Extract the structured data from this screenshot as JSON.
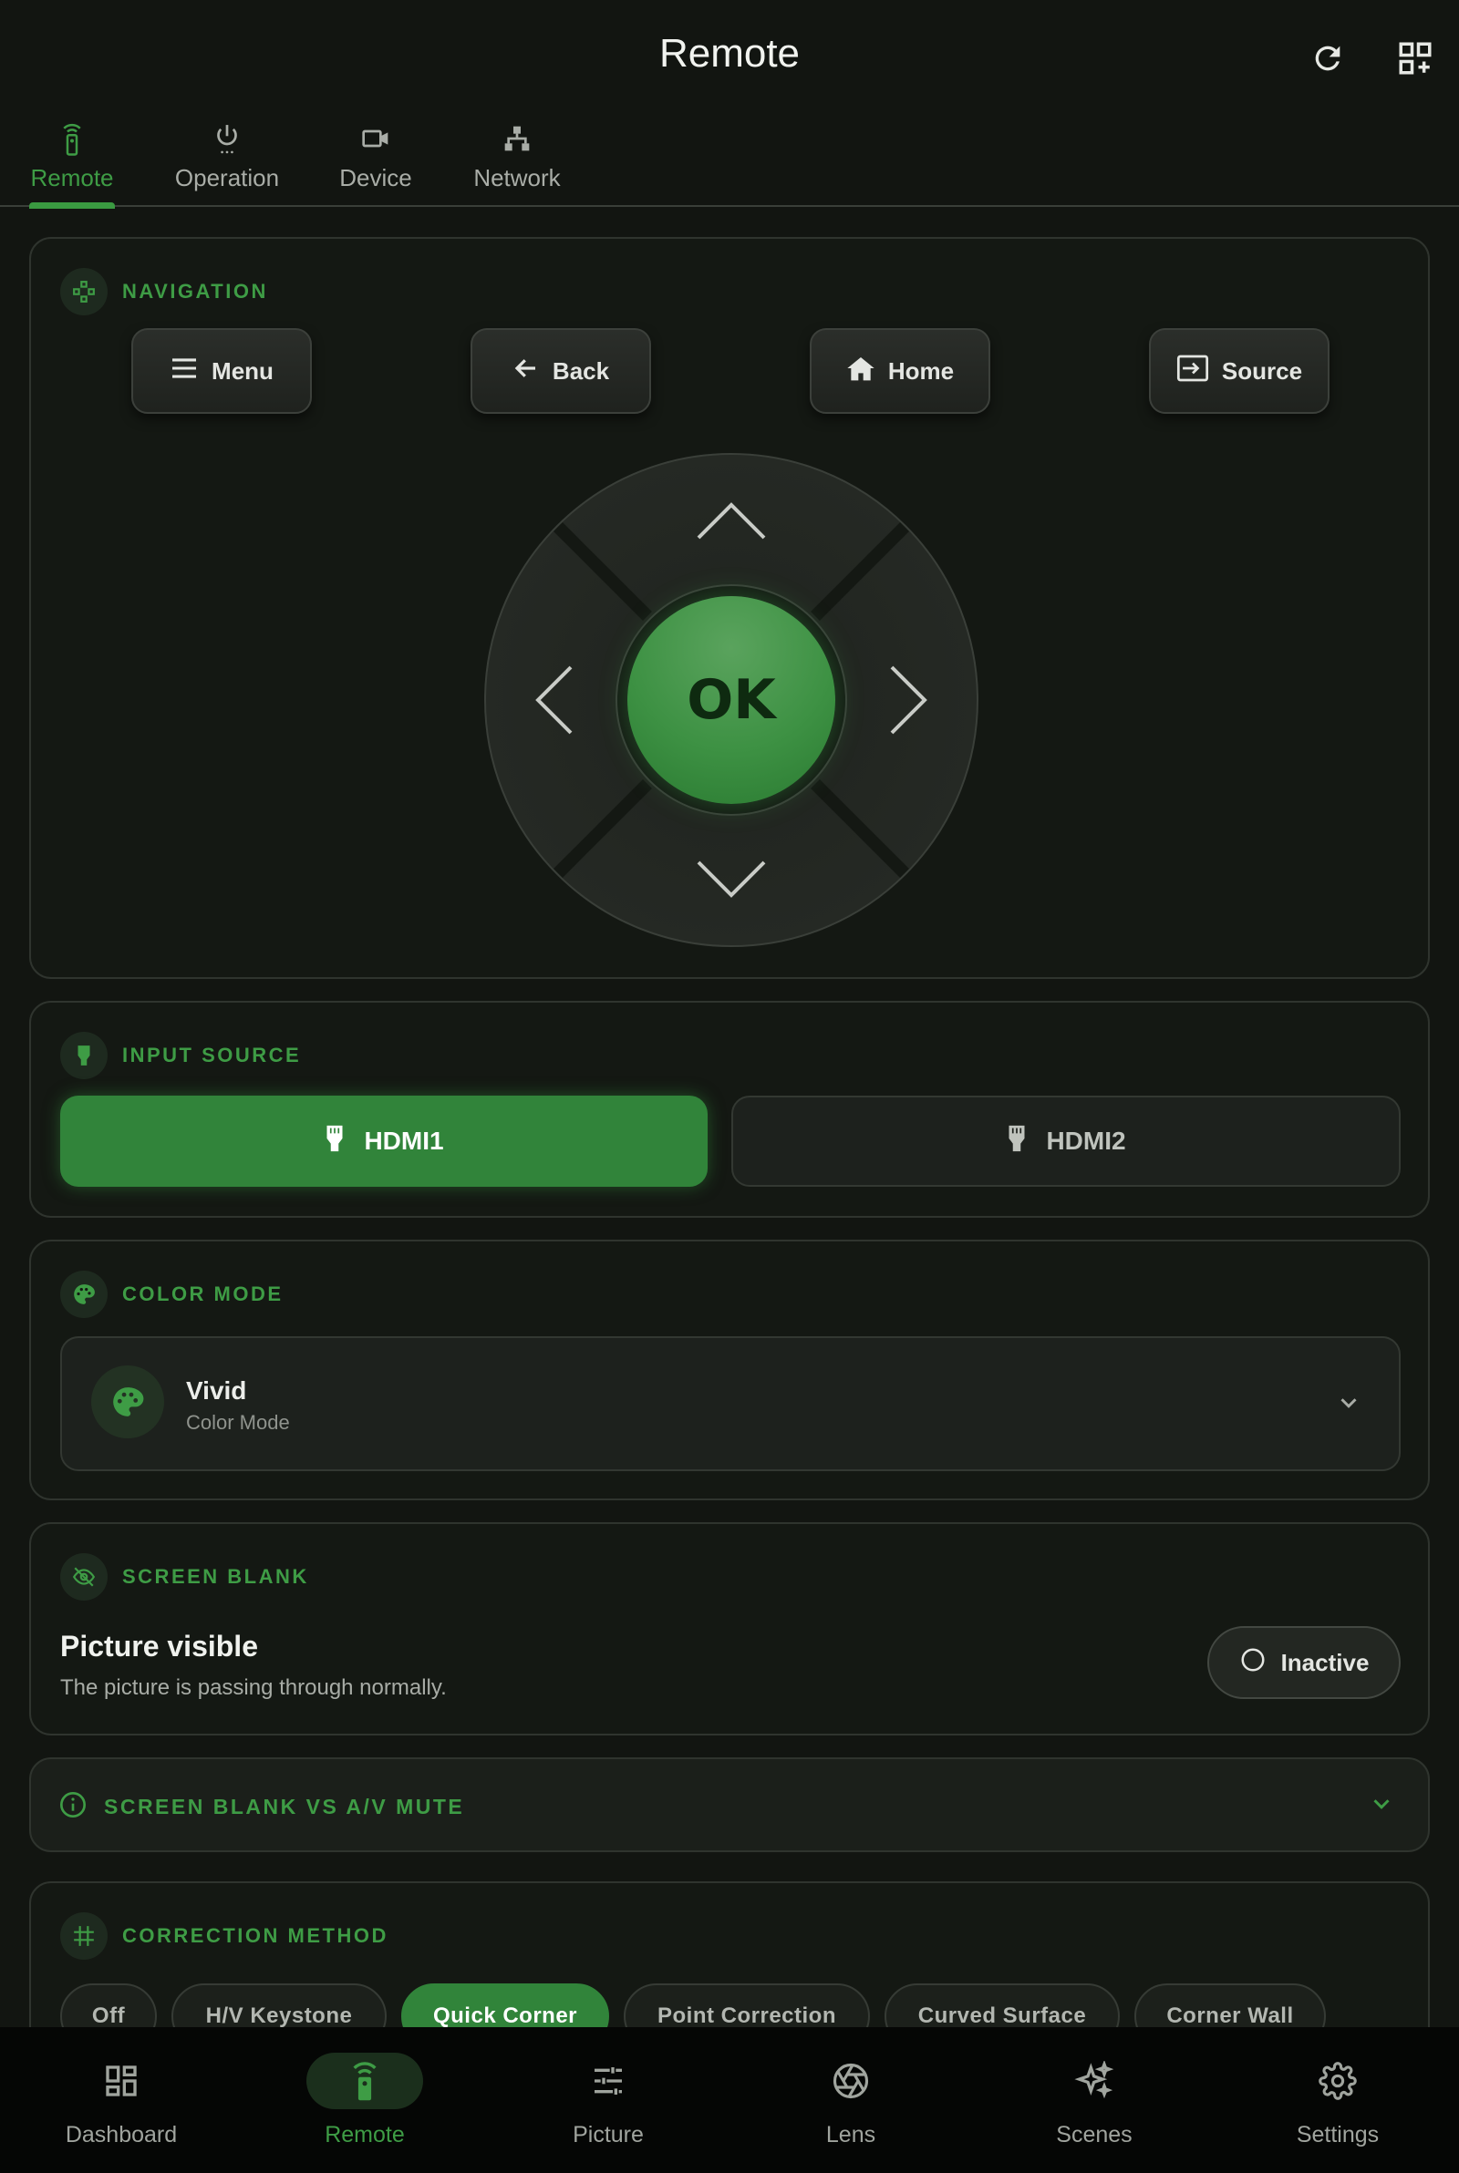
{
  "app": {
    "title": "Remote"
  },
  "tabs": [
    {
      "label": "Remote",
      "icon": "remote-icon",
      "active": true
    },
    {
      "label": "Operation",
      "icon": "power-icon"
    },
    {
      "label": "Device",
      "icon": "video-camera-icon"
    },
    {
      "label": "Network",
      "icon": "network-icon"
    }
  ],
  "navigation": {
    "label": "NAVIGATION",
    "buttons": {
      "menu": "Menu",
      "back": "Back",
      "home": "Home",
      "source": "Source"
    },
    "ok": "OK"
  },
  "input_source": {
    "label": "INPUT SOURCE",
    "options": [
      "HDMI1",
      "HDMI2"
    ],
    "selected": "HDMI1"
  },
  "color_mode": {
    "label": "COLOR MODE",
    "value": "Vivid",
    "sublabel": "Color Mode"
  },
  "screen_blank": {
    "label": "SCREEN BLANK",
    "title": "Picture visible",
    "description": "The picture is passing through normally.",
    "status": "Inactive"
  },
  "info": {
    "label": "SCREEN BLANK VS A/V MUTE"
  },
  "correction": {
    "label": "CORRECTION METHOD",
    "options": [
      "Off",
      "H/V Keystone",
      "Quick Corner",
      "Point Correction",
      "Curved Surface",
      "Corner Wall"
    ],
    "selected": "Quick Corner"
  },
  "bottom_nav": [
    {
      "label": "Dashboard",
      "icon": "dashboard-icon"
    },
    {
      "label": "Remote",
      "icon": "remote-icon",
      "active": true
    },
    {
      "label": "Picture",
      "icon": "sliders-icon"
    },
    {
      "label": "Lens",
      "icon": "aperture-icon"
    },
    {
      "label": "Scenes",
      "icon": "sparkles-icon"
    },
    {
      "label": "Settings",
      "icon": "gear-icon"
    }
  ],
  "colors": {
    "accent": "#3a9a41",
    "background": "#121511",
    "card": "#141813"
  }
}
